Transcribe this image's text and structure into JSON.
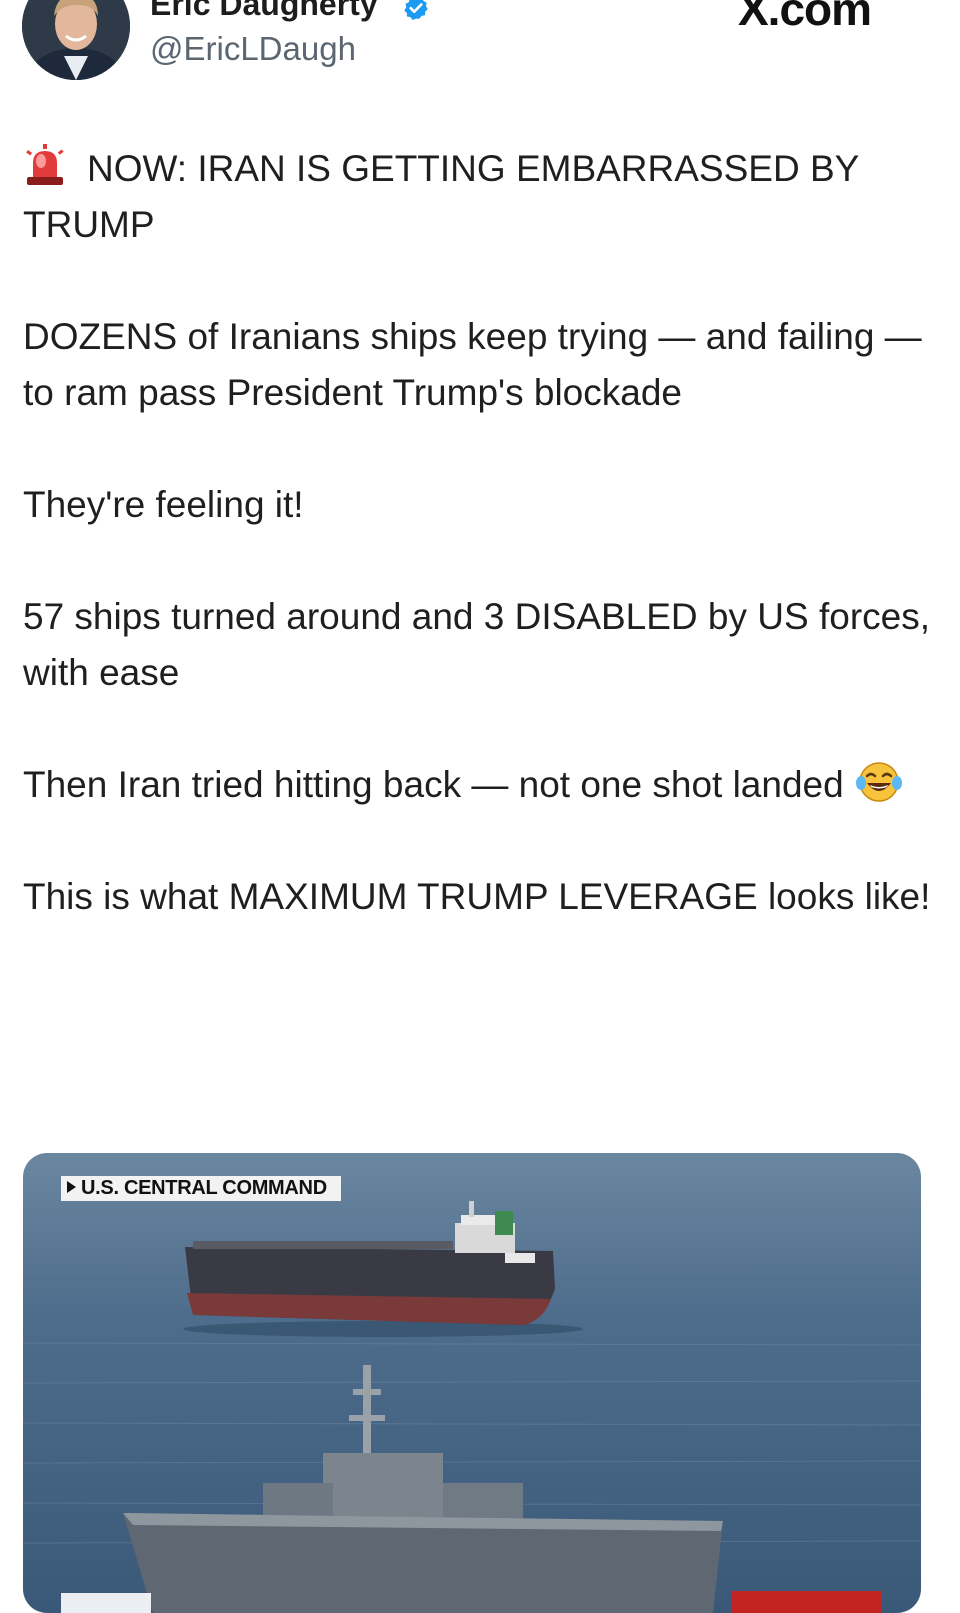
{
  "author": {
    "display_name": "Eric Daugherty",
    "handle": "@EricLDaugh",
    "verified_icon": "verified-badge-icon",
    "avatar_icon": "avatar-photo"
  },
  "site_logo": "X.com",
  "tweet": {
    "line1_prefix_icon": "police-siren-emoji",
    "line1": "NOW: IRAN IS GETTING EMBARRASSED BY TRUMP",
    "p2": "DOZENS of Iranians ships keep trying — and failing — to ram pass President Trump's blockade",
    "p3": "They're feeling it!",
    "p4": "57 ships turned around and 3 DISABLED by US forces, with ease",
    "p5": "Then Iran tried hitting back — not one shot landed",
    "p5_suffix_icon": "tears-of-joy-emoji",
    "p6": "This is what MAXIMUM TRUMP LEVERAGE looks like!"
  },
  "media": {
    "source_label": "U.S. CENTRAL COMMAND"
  },
  "colors": {
    "verified_blue": "#1d9bf0",
    "handle_gray": "#5b6670",
    "sea": "#3f5f80"
  }
}
